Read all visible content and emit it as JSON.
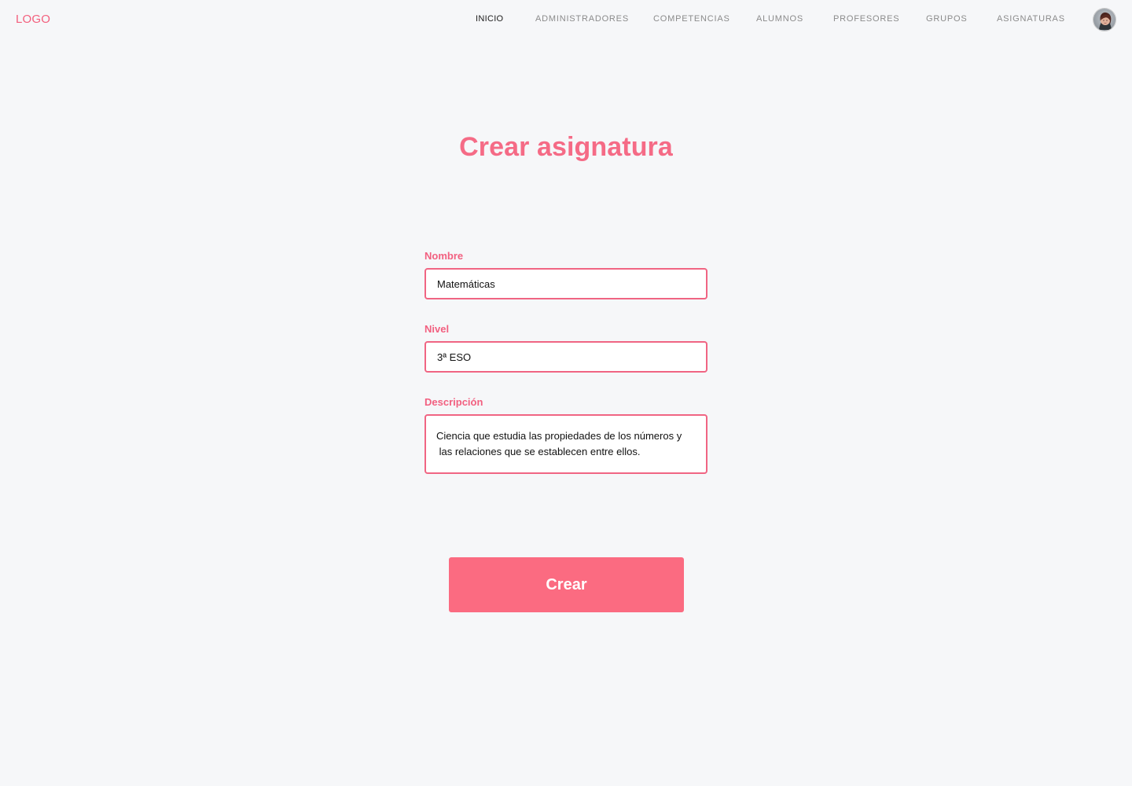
{
  "header": {
    "logo": "LOGO",
    "nav": [
      {
        "label": "INICIO",
        "active": true
      },
      {
        "label": "ADMINISTRADORES",
        "active": false
      },
      {
        "label": "COMPETENCIAS",
        "active": false
      },
      {
        "label": "ALUMNOS",
        "active": false
      },
      {
        "label": "PROFESORES",
        "active": false
      },
      {
        "label": "GRUPOS",
        "active": false
      },
      {
        "label": "ASIGNATURAS",
        "active": false
      }
    ],
    "avatar_icon": "user-avatar-icon"
  },
  "main": {
    "title": "Crear asignatura",
    "fields": [
      {
        "label": "Nombre",
        "value": "Matemáticas"
      },
      {
        "label": "Nivel",
        "value": "3ª ESO"
      },
      {
        "label": "Descripción",
        "value": "Ciencia que estudia las propiedades de los números y\n las relaciones que se establecen entre ellos."
      }
    ],
    "submit_label": "Crear"
  },
  "colors": {
    "background": "#f6f7f9",
    "accent": "#f56b86",
    "button": "#fb6b81",
    "nav_inactive": "#8b8b8b",
    "nav_active": "#202020"
  }
}
